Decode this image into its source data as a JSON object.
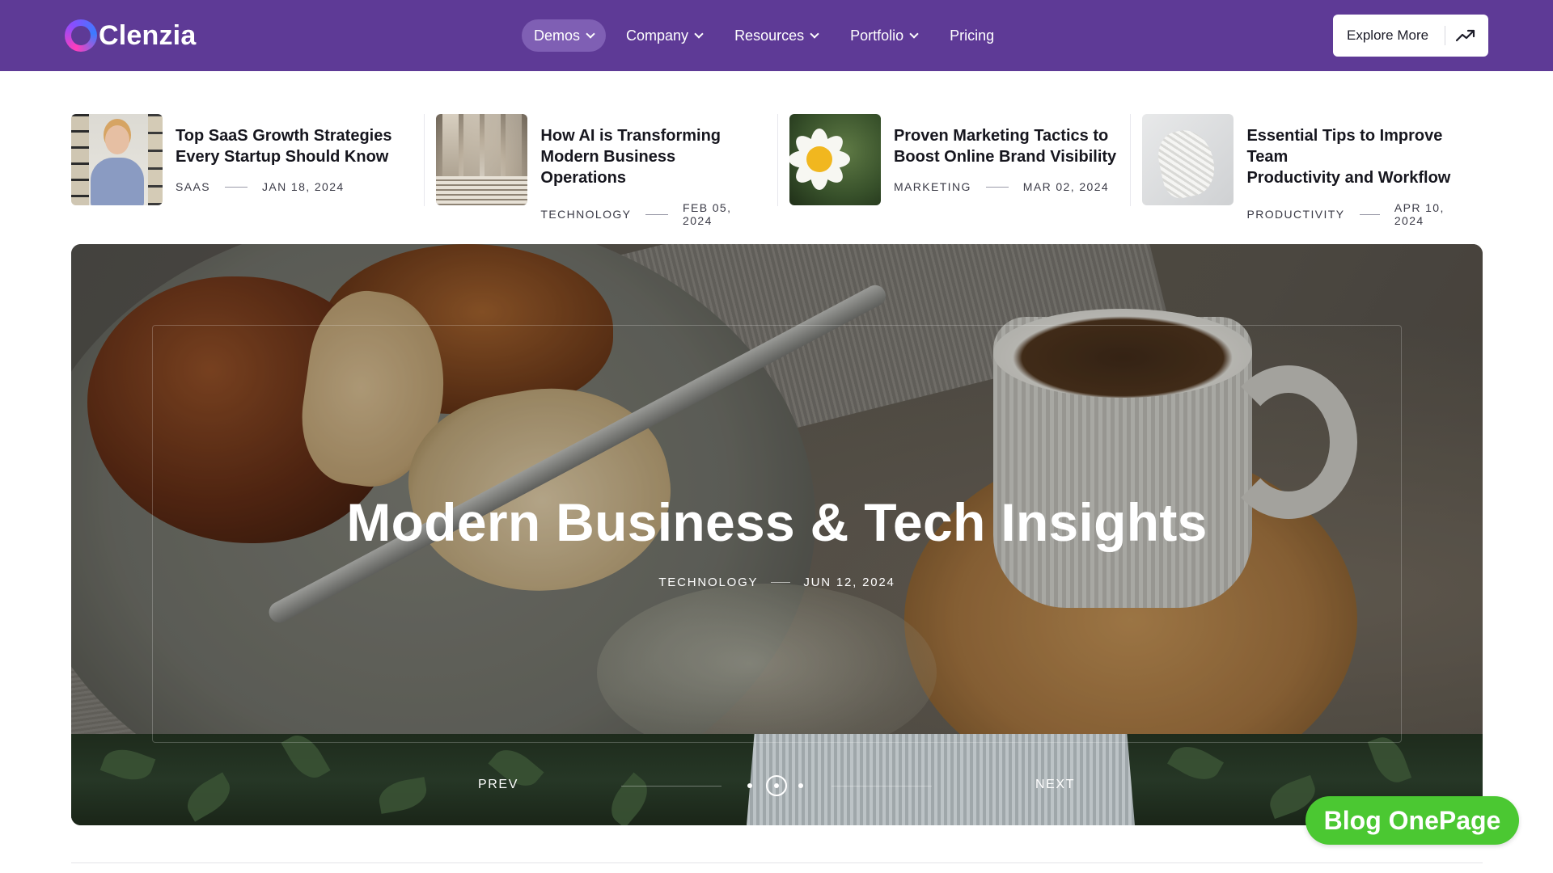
{
  "brand": {
    "name": "Clenzia",
    "accent": "#5e3a96",
    "badge_color": "#4bc832"
  },
  "nav": {
    "items": [
      {
        "label": "Demos",
        "has_dropdown": true,
        "active": true
      },
      {
        "label": "Company",
        "has_dropdown": true,
        "active": false
      },
      {
        "label": "Resources",
        "has_dropdown": true,
        "active": false
      },
      {
        "label": "Portfolio",
        "has_dropdown": true,
        "active": false
      },
      {
        "label": "Pricing",
        "has_dropdown": false,
        "active": false
      }
    ],
    "cta_label": "Explore More",
    "cta_icon": "trending-up-arrow-icon"
  },
  "posts": [
    {
      "title_line1": "Top SaaS Growth Strategies",
      "title_line2": "Every Startup Should Know",
      "category": "SAAS",
      "date": "JAN 18, 2024",
      "thumb": "woman-at-desk-image"
    },
    {
      "title_line1": "How AI is Transforming",
      "title_line2": "Modern Business Operations",
      "category": "TECHNOLOGY",
      "date": "FEB 05, 2024",
      "thumb": "arched-corridor-image"
    },
    {
      "title_line1": "Proven Marketing Tactics to",
      "title_line2": "Boost Online Brand Visibility",
      "category": "MARKETING",
      "date": "MAR 02, 2024",
      "thumb": "daisy-flower-image"
    },
    {
      "title_line1": "Essential Tips to Improve Team",
      "title_line2": "Productivity and Workflow",
      "category": "PRODUCTIVITY",
      "date": "APR 10, 2024",
      "thumb": "knitted-fabric-image"
    }
  ],
  "hero": {
    "title": "Modern Business & Tech Insights",
    "category": "TECHNOLOGY",
    "date": "JUN 12, 2024",
    "prev_label": "PREV",
    "next_label": "NEXT",
    "slides_count": 3,
    "active_slide": 2
  },
  "badge": {
    "label": "Blog OnePage"
  }
}
